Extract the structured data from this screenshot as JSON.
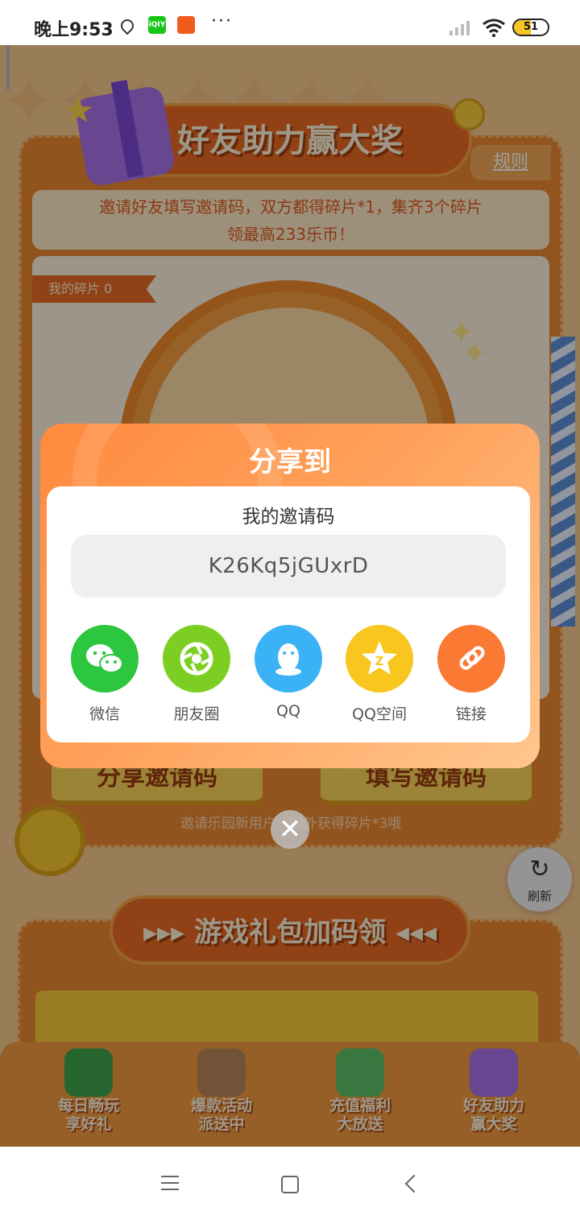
{
  "status_bar": {
    "time": "晚上9:53",
    "battery": "51",
    "battery_level": 0.51,
    "icons": [
      "location-icon",
      "iqiyi-app-icon",
      "app-notification-icon",
      "more-dots-icon",
      "signal-icon",
      "wifi-icon",
      "battery-icon"
    ],
    "more": "···"
  },
  "background": {
    "title": "好友助力赢大奖",
    "rules": "规则",
    "notice_line1": "邀请好友填写邀请码，双方都得碎片*1，集齐3个碎片",
    "notice_line2": "领最高233乐币！",
    "my_pieces": "我的碎片 0",
    "share_code_button": "分享邀请码",
    "fill_code_button": "填写邀请码",
    "invite_tip": "邀请乐园新用户，额外获得碎片*3哦",
    "section2_title": "▸▸▸ 游戏礼包加码领 ◂◂◂",
    "refresh_label": "刷新"
  },
  "tabbar": {
    "items": [
      {
        "label": "每日畅玩\n享好礼",
        "icon": "palm-island-icon",
        "color": "#3ea44a"
      },
      {
        "label": "爆款活动\n派送中",
        "icon": "summer-sign-icon",
        "color": "#b8875a"
      },
      {
        "label": "充值福利\n大放送",
        "icon": "coconut-drink-icon",
        "color": "#5cc36a"
      },
      {
        "label": "好友助力\n赢大奖",
        "icon": "gift-box-icon",
        "color": "#a871e8"
      }
    ]
  },
  "share_modal": {
    "title": "分享到",
    "code_label": "我的邀请码",
    "invite_code": "K26Kq5jGUxrD",
    "options": [
      {
        "label": "微信",
        "icon": "wechat-icon",
        "color": "#2dc63f"
      },
      {
        "label": "朋友圈",
        "icon": "moments-icon",
        "color": "#7ccf22"
      },
      {
        "label": "QQ",
        "icon": "qq-icon",
        "color": "#3cb2f6"
      },
      {
        "label": "QQ空间",
        "icon": "qzone-icon",
        "color": "#f9c620"
      },
      {
        "label": "链接",
        "icon": "link-icon",
        "color": "#fb7a33"
      }
    ],
    "close": "✕"
  },
  "nav": {
    "icons": [
      "menu-icon",
      "home-icon",
      "back-icon"
    ]
  }
}
